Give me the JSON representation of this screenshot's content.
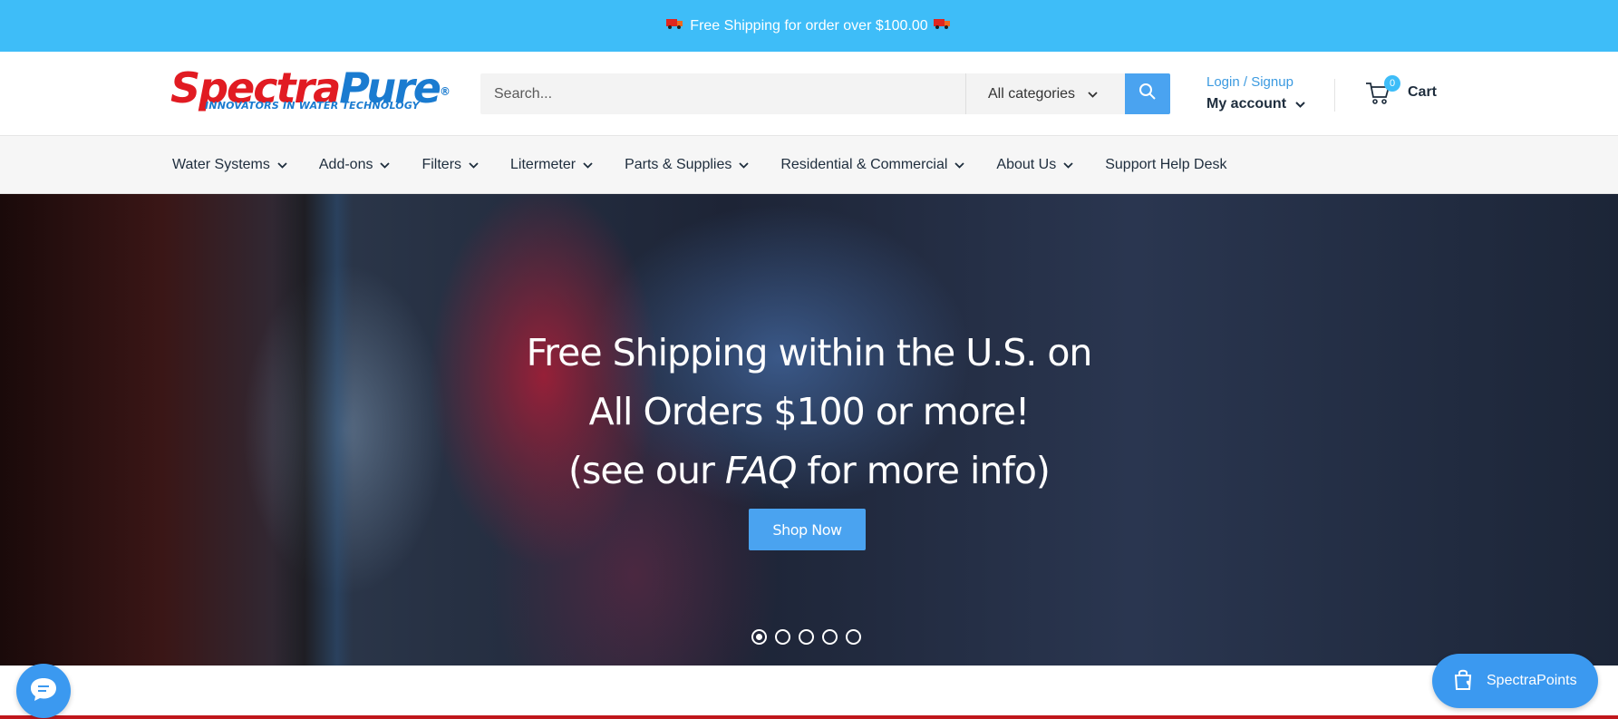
{
  "announcement": {
    "text": "Free Shipping for order over $100.00"
  },
  "logo": {
    "brand_a": "Spectra",
    "brand_b": "Pure",
    "registered": "®",
    "tagline": "INNOVATORS IN WATER TECHNOLOGY"
  },
  "search": {
    "placeholder": "Search...",
    "category": "All categories"
  },
  "account": {
    "login": "Login / Signup",
    "my_account": "My account"
  },
  "cart": {
    "count": "0",
    "label": "Cart"
  },
  "nav": [
    {
      "label": "Water Systems"
    },
    {
      "label": "Add-ons"
    },
    {
      "label": "Filters"
    },
    {
      "label": "Litermeter"
    },
    {
      "label": "Parts & Supplies"
    },
    {
      "label": "Residential & Commercial"
    },
    {
      "label": "About Us"
    },
    {
      "label": "Support Help Desk"
    }
  ],
  "hero": {
    "line1": "Free Shipping within the U.S. on",
    "line2": "All Orders $100 or more!",
    "line3_pre": "(see our ",
    "line3_em": "FAQ",
    "line3_post": " for more info)",
    "button": "Shop Now",
    "slide_count": 5,
    "active_slide": 1
  },
  "widgets": {
    "points_label": "SpectraPoints"
  },
  "colors": {
    "accent": "#3ebdf8",
    "button": "#4aa3f0",
    "text": "#1e2d3d"
  }
}
